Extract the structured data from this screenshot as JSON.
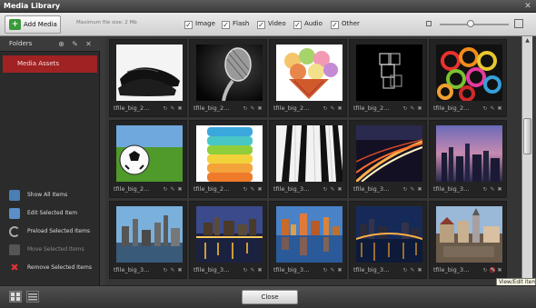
{
  "window": {
    "title": "Media Library"
  },
  "toolbar": {
    "add_media_label": "Add Media",
    "max_file_size": "Maximum file size: 2 Mb",
    "filters": [
      {
        "label": "Image",
        "checked": true
      },
      {
        "label": "Flash",
        "checked": true
      },
      {
        "label": "Video",
        "checked": true
      },
      {
        "label": "Audio",
        "checked": true
      },
      {
        "label": "Other",
        "checked": true
      }
    ],
    "thumbnail_size_fraction": 0.45
  },
  "sidebar": {
    "folders_label": "Folders",
    "header_icons": [
      "add-folder-icon",
      "edit-icon",
      "delete-icon"
    ],
    "folders": [
      {
        "label": "Media Assets",
        "selected": true
      }
    ],
    "actions": [
      {
        "label": "Show All Items",
        "icon": "show-all-icon",
        "enabled": true
      },
      {
        "label": "Edit Selected Item",
        "icon": "edit-selected-icon",
        "enabled": true
      },
      {
        "label": "Preload Selected Items",
        "icon": "preload-icon",
        "enabled": true
      },
      {
        "label": "Move Selected Items",
        "icon": "move-icon",
        "enabled": false
      },
      {
        "label": "Remove Selected Items",
        "icon": "remove-icon",
        "enabled": true
      }
    ]
  },
  "grid": {
    "items": [
      {
        "name": "tfile_big_2...",
        "image": "black leather shoes"
      },
      {
        "name": "tfile_big_2...",
        "image": "microphone"
      },
      {
        "name": "tfile_big_2...",
        "image": "ice cream cones"
      },
      {
        "name": "tfile_big_2...",
        "image": "ice cubes"
      },
      {
        "name": "tfile_big_2...",
        "image": "colorful rolls"
      },
      {
        "name": "tfile_big_2...",
        "image": "soccer ball on grass"
      },
      {
        "name": "tfile_big_2...",
        "image": "colored towels"
      },
      {
        "name": "tfile_big_3...",
        "image": "piano keys"
      },
      {
        "name": "tfile_big_3...",
        "image": "city light trails"
      },
      {
        "name": "tfile_big_3...",
        "image": "city at dusk"
      },
      {
        "name": "tfile_big_3...",
        "image": "city skyline"
      },
      {
        "name": "tfile_big_3...",
        "image": "city at night by water"
      },
      {
        "name": "tfile_big_3...",
        "image": "skyline reflection"
      },
      {
        "name": "tfile_big_3...",
        "image": "bridge at night"
      },
      {
        "name": "tfile_big_3...",
        "image": "old town square"
      }
    ]
  },
  "tooltip": {
    "text": "View/Edit item"
  },
  "footer": {
    "close_label": "Close"
  },
  "colors": {
    "selected_folder": "#a02222",
    "panel_bg": "#2b2b2b",
    "grid_bg": "#353535"
  }
}
